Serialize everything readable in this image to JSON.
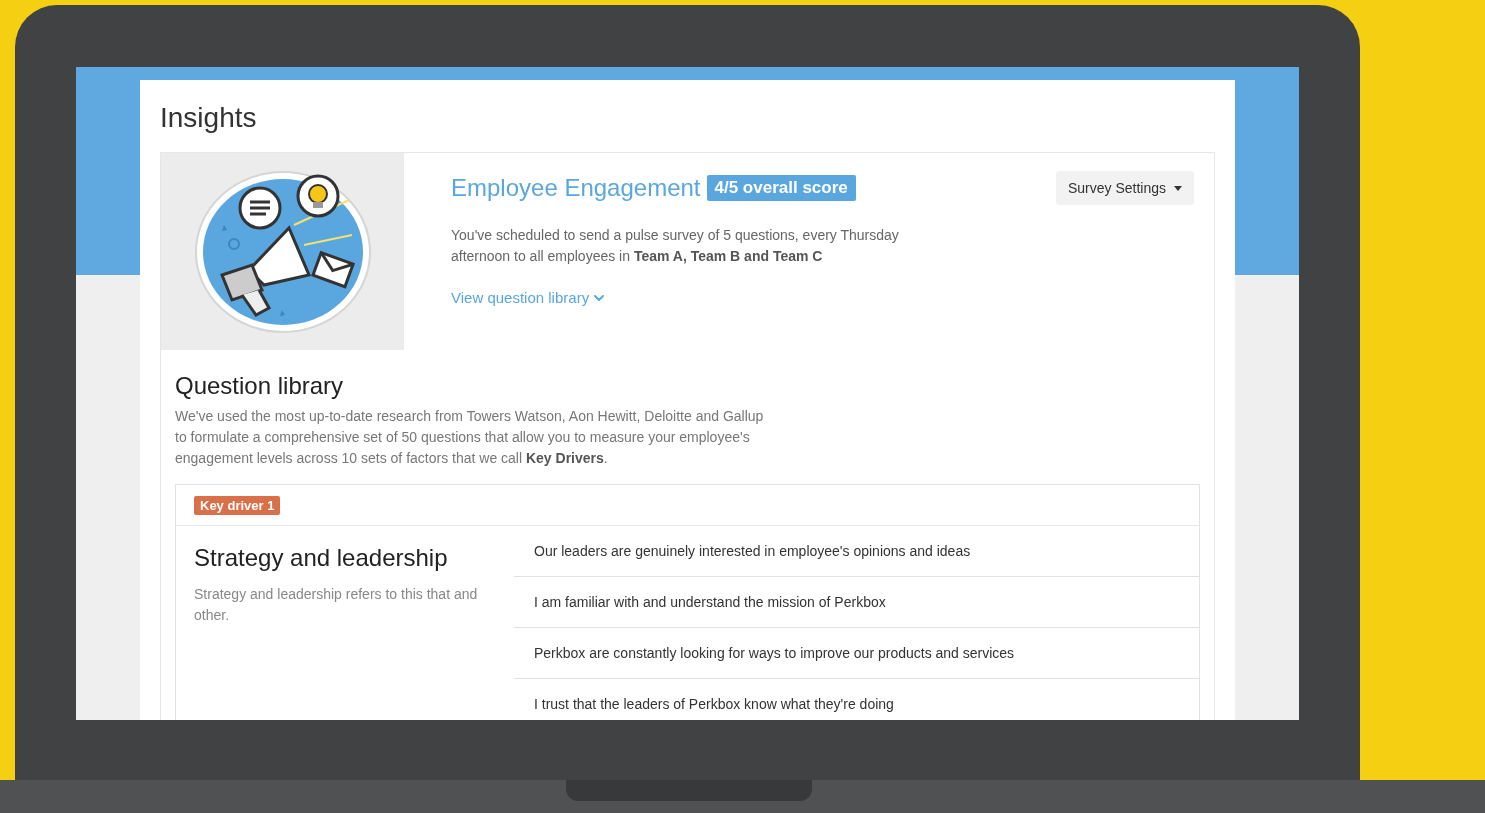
{
  "page": {
    "title": "Insights"
  },
  "survey": {
    "title": "Employee Engagement",
    "score_badge": "4/5 overall score",
    "description": "You've scheduled to send a pulse survey of 5 questions, every Thursday afternoon to all employees in **Team A, Team B and Team C**",
    "library_link": "View question library",
    "settings_button": "Survey Settings"
  },
  "question_library": {
    "title": "Question library",
    "description": "We've used the most up-to-date research from Towers Watson, Aon Hewitt, Deloitte and Gallup to formulate a comprehensive set of 50 questions that allow you to measure your employee's engagement levels across 10 sets of factors that we call **Key Drivers**."
  },
  "key_drivers": [
    {
      "badge": "Key driver 1",
      "title": "Strategy and leadership",
      "description": "Strategy and leadership refers to this that and other.",
      "questions": [
        "Our leaders are genuinely interested in employee's opinions and ideas",
        "I am familiar with and understand the mission of Perkbox",
        "Perkbox are constantly looking for ways to improve our products and services",
        "I trust that the leaders of Perkbox know what they're doing"
      ]
    }
  ]
}
